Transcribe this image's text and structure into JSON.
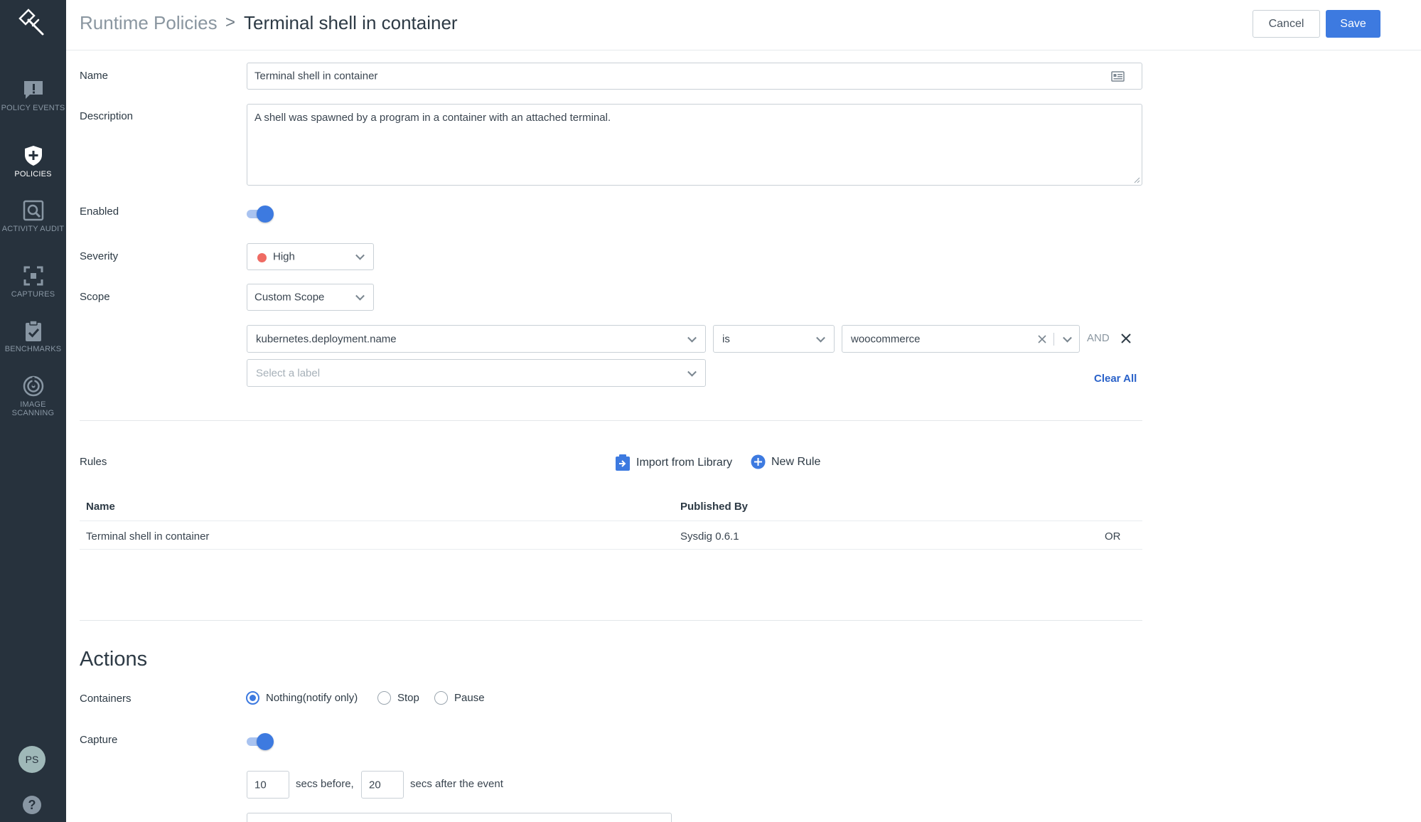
{
  "sidebar": {
    "items": [
      {
        "label": "POLICY EVENTS",
        "icon": "chat-alert-icon"
      },
      {
        "label": "POLICIES",
        "icon": "shield-plus-icon"
      },
      {
        "label": "ACTIVITY AUDIT",
        "icon": "search-square-icon"
      },
      {
        "label": "CAPTURES",
        "icon": "capture-frame-icon"
      },
      {
        "label": "BENCHMARKS",
        "icon": "clipboard-check-icon"
      },
      {
        "label": "IMAGE SCANNING",
        "icon": "radar-icon"
      }
    ],
    "active_index": 1,
    "avatar_initials": "PS",
    "help_glyph": "?"
  },
  "header": {
    "breadcrumb_root": "Runtime Policies",
    "breadcrumb_sep": ">",
    "title": "Terminal shell in container",
    "cancel_label": "Cancel",
    "save_label": "Save"
  },
  "form": {
    "name_label": "Name",
    "name_value": "Terminal shell in container",
    "description_label": "Description",
    "description_value": "A shell was spawned by a program in a container with an attached terminal.",
    "enabled_label": "Enabled",
    "enabled": true,
    "severity_label": "Severity",
    "severity_value": "High",
    "severity_color": "#ef6b63",
    "scope_label": "Scope",
    "scope_value": "Custom Scope",
    "scope_rule": {
      "key": "kubernetes.deployment.name",
      "operator": "is",
      "value": "woocommerce",
      "joiner": "AND"
    },
    "label_placeholder": "Select a label",
    "clear_all": "Clear All"
  },
  "rules": {
    "label": "Rules",
    "import_label": "Import from Library",
    "new_rule_label": "New Rule",
    "columns": [
      "Name",
      "Published By"
    ],
    "rows": [
      {
        "name": "Terminal shell in container",
        "published_by": "Sysdig 0.6.1",
        "joiner": "OR"
      }
    ]
  },
  "actions": {
    "title": "Actions",
    "containers_label": "Containers",
    "container_options": [
      "Nothing(notify only)",
      "Stop",
      "Pause"
    ],
    "selected_option": 0,
    "capture_label": "Capture",
    "capture_enabled": true,
    "secs_before": "10",
    "secs_before_text": "secs before,",
    "secs_after": "20",
    "secs_after_text": "secs after the event"
  },
  "colors": {
    "sidebar_bg": "#27323d",
    "accent": "#3d7ae0",
    "link": "#2a62c9"
  }
}
